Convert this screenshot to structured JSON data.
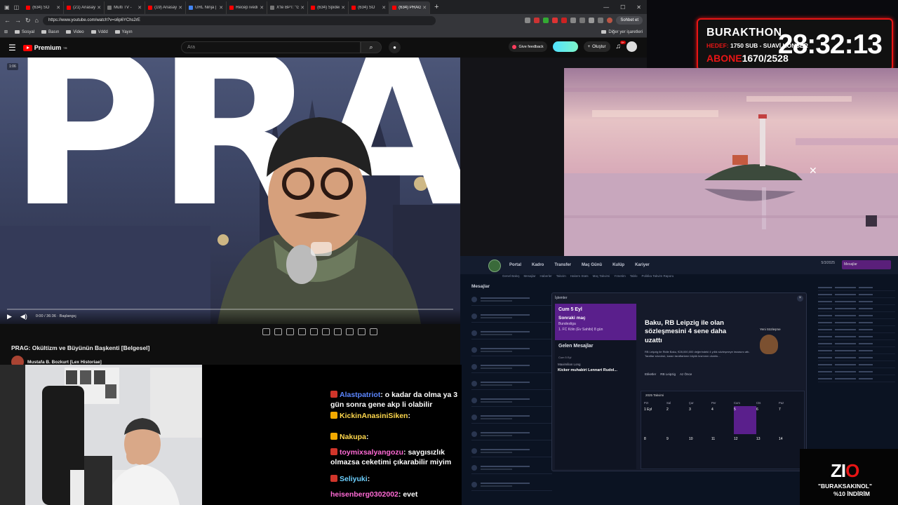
{
  "browser": {
    "tabs": [
      {
        "label": "(634) SO",
        "fav": "red"
      },
      {
        "label": "(21) Anasayf",
        "fav": "red"
      },
      {
        "label": "Multi TV -",
        "fav": "gray"
      },
      {
        "label": "(19) Anasayf",
        "fav": "red"
      },
      {
        "label": "URL Ninja |",
        "fav": "blue"
      },
      {
        "label": "Recep ivedi",
        "fav": "red"
      },
      {
        "label": "X'te BPT: \"G",
        "fav": "gray"
      },
      {
        "label": "(634) Spider",
        "fav": "red"
      },
      {
        "label": "(634) SO",
        "fav": "red"
      },
      {
        "label": "(634) PRAG",
        "fav": "red",
        "active": true
      }
    ],
    "url": "https://www.youtube.com/watch?v=s6p6YChs2rE",
    "sohbet_label": "Sohbet et",
    "bookmarks": [
      "Sosyal",
      "Basın",
      "Video",
      "Vddd",
      "Yayın"
    ],
    "other_bookmarks": "Diğer yer işaretleri"
  },
  "youtube": {
    "logo": "Premium",
    "logo_sup": "TR",
    "search_placeholder": "Ara",
    "give_feedback": "Give feedback",
    "create": "Oluştur",
    "bell_badge": "9+",
    "video_counter": "1:06",
    "time": "0:00 / 36:36 · Başlangıç",
    "progress_fraction": 0.0,
    "title_letters": "PRAG",
    "video_title": "PRAG: Okültizm ve Büyünün Başkenti [Belgesel]",
    "channel": "Mustafa B. Bozkurt [Lex Historiae]"
  },
  "overlay": {
    "name": "BURAKTHON",
    "hedef_label": "HEDEF:",
    "hedef_text": "1750 SUB - SUAVİ KONSER",
    "abone_label": "ABONE",
    "abone_value": "1670/2528",
    "timer": "28:32:13"
  },
  "fm": {
    "nav": [
      "Portal",
      "Kadro",
      "Transfer",
      "Maç Günü",
      "Kulüp",
      "Kariyer"
    ],
    "sub_nav": [
      "Genel Bakış",
      "Mesajlar",
      "Haberler",
      "Takvim",
      "Hakem Stats",
      "Maç Takvimi",
      "Yönetim",
      "Tablo",
      "Politika Takvim Raporu"
    ],
    "date": "5/3/2025",
    "date_pill": "Mesajlar",
    "left_header": "Mesajlar",
    "inbox_title": "İşlemler",
    "card_date": "Cum 5 Eyl",
    "card_title": "Sonraki maç",
    "card_line1": "Bundesliga",
    "card_line2": "1. FC Köln (Ev Sahibi) 8 gün",
    "gelen": "Gelen Mesajlar",
    "gelen_date": "Cum 5 Eyl",
    "msg_from": "Maximilian Long",
    "msg_subject": "Kicker muhabiri Lennart Rudol...",
    "news_headline": "Baku, RB Leipzig ile olan sözleşmesini 4 sene daha uzattı",
    "news_para": "RB Leipzig ile Ridle Baku, €28,000,000 değerindeki 4 yıllık sözleşmeye imzasını attı. Taraftar sözcüsü, kararı taraftarların büyük kısmının olumlu...",
    "news_tags": [
      "Etiketler",
      "RB Leipzig",
      "Az Önce"
    ],
    "contract_label": "Yeni Sözleşme",
    "calendar_title": "2025 Takvimi",
    "calendar_days": [
      "Pzt",
      "Sal",
      "Çar",
      "Per",
      "Cum",
      "Cts",
      "Paz"
    ],
    "calendar_dates": [
      "1 Eyl",
      "2",
      "3",
      "4",
      "5",
      "6",
      "7",
      "8",
      "9",
      "10",
      "11",
      "12",
      "13",
      "14"
    ]
  },
  "chat": [
    {
      "user": "Alastpatriot",
      "msg": "o kadar da olma ya 3 gün sonra gene akp li olabilir",
      "color": "c1",
      "badge": "r"
    },
    {
      "user": "KickinAnasiniSiken",
      "msg": "",
      "color": "c2",
      "badge": "y"
    },
    {
      "user": "Nakupa",
      "msg": "",
      "color": "c2",
      "badge": "y"
    },
    {
      "user": "toymixsalyangozu",
      "msg": "saygısızlık olmazsa ceketimi çıkarabilir miyim",
      "color": "c3",
      "badge": "r"
    },
    {
      "user": "Seliyuki",
      "msg": "",
      "color": "c4",
      "badge": "r"
    },
    {
      "user": "heisenberg0302002",
      "msg": "evet",
      "color": "c3",
      "badge": ""
    }
  ],
  "sponsor": {
    "brand_a": "ZI",
    "brand_b": "O",
    "line1": "\"BURAKSAKINOL\"",
    "line2": "%10 İNDİRİM"
  }
}
